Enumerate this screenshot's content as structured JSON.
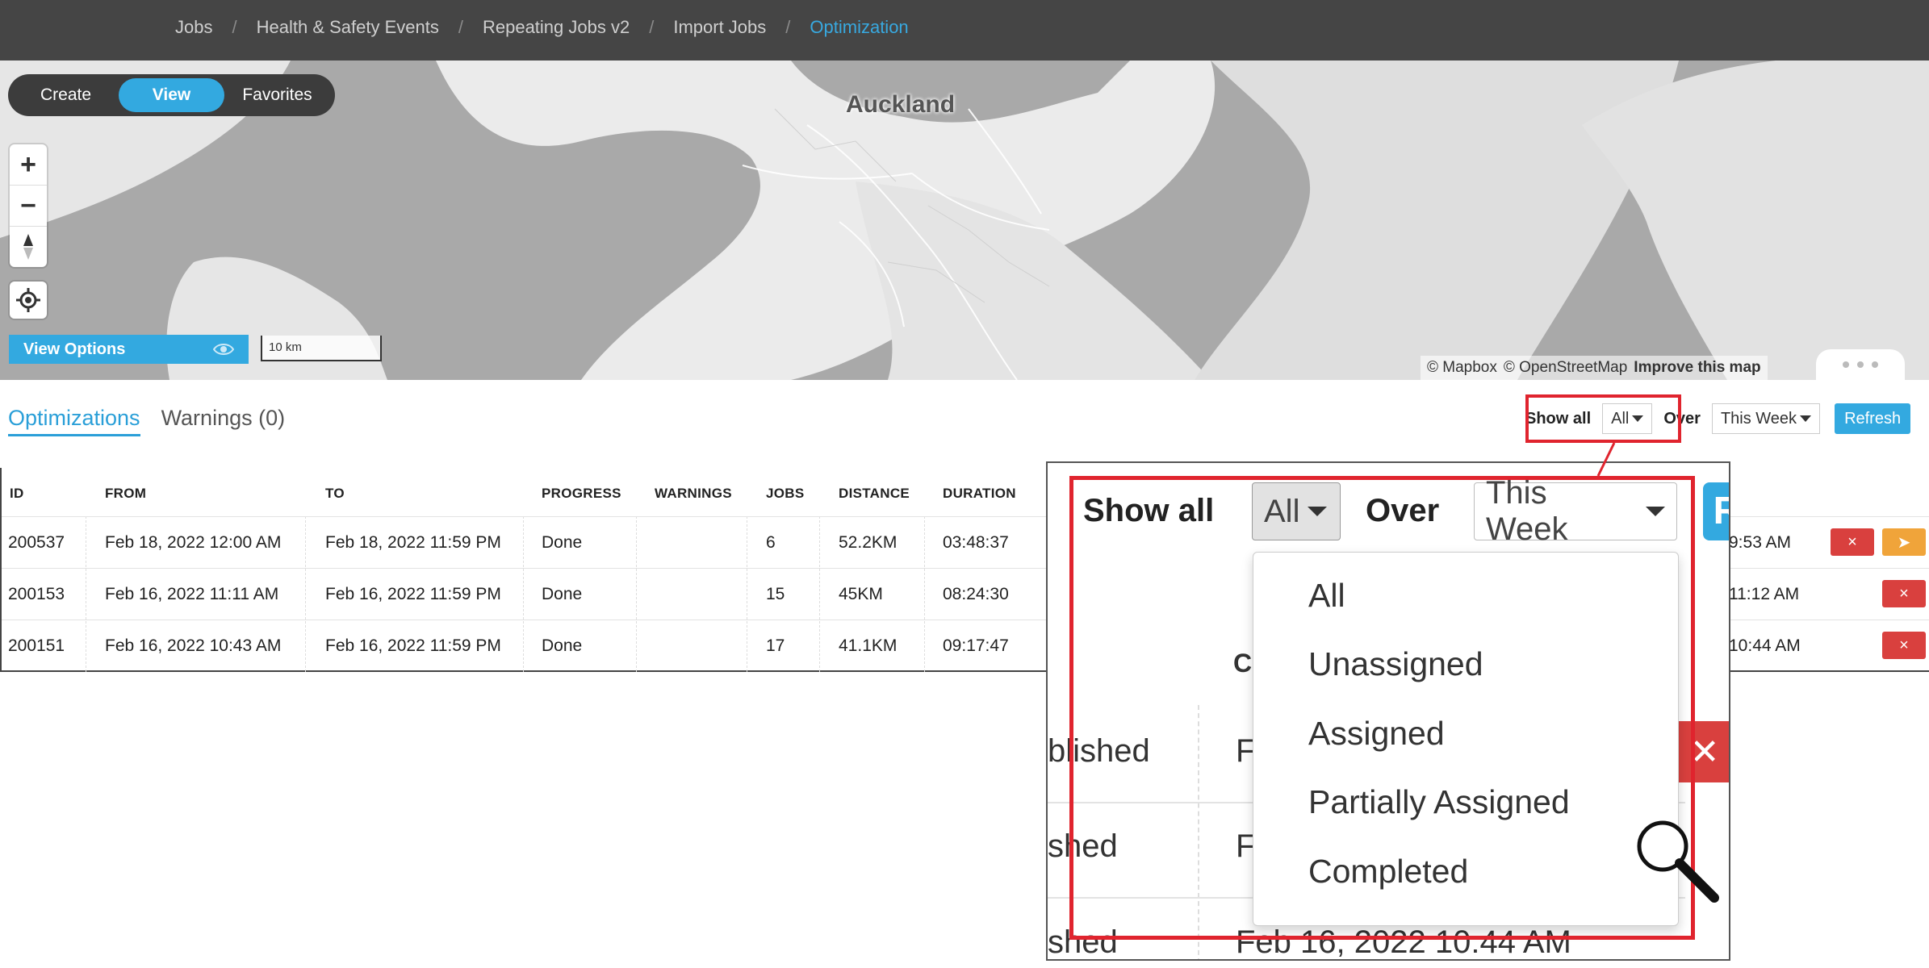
{
  "breadcrumbs": [
    "Jobs",
    "Health & Safety Events",
    "Repeating Jobs v2",
    "Import Jobs",
    "Optimization"
  ],
  "mode_toggle": {
    "create": "Create",
    "view": "View",
    "favorites": "Favorites",
    "active": "View"
  },
  "map": {
    "city_label": "Auckland",
    "zoom_in": "+",
    "zoom_out": "−",
    "view_options_label": "View Options",
    "scale_label": "10 km",
    "attribution_mapbox": "© Mapbox",
    "attribution_osm": "© OpenStreetMap",
    "improve_link": "Improve this map"
  },
  "tabs": {
    "optimizations": "Optimizations",
    "warnings": "Warnings (0)"
  },
  "filters": {
    "show_all_label": "Show all",
    "show_value": "All",
    "over_label": "Over",
    "over_value": "This Week",
    "refresh_label": "Refresh"
  },
  "table": {
    "columns": [
      "ID",
      "FROM",
      "TO",
      "PROGRESS",
      "WARNINGS",
      "JOBS",
      "DISTANCE",
      "DURATION"
    ],
    "rows": [
      {
        "id": "200537",
        "from": "Feb 18, 2022 12:00 AM",
        "to": "Feb 18, 2022 11:59 PM",
        "progress": "Done",
        "warnings": "",
        "jobs": "6",
        "distance": "52.2KM",
        "duration": "03:48:37",
        "created": "9:53 AM"
      },
      {
        "id": "200153",
        "from": "Feb 16, 2022 11:11 AM",
        "to": "Feb 16, 2022 11:59 PM",
        "progress": "Done",
        "warnings": "",
        "jobs": "15",
        "distance": "45KM",
        "duration": "08:24:30",
        "created": "11:12 AM"
      },
      {
        "id": "200151",
        "from": "Feb 16, 2022 10:43 AM",
        "to": "Feb 16, 2022 11:59 PM",
        "progress": "Done",
        "warnings": "",
        "jobs": "17",
        "distance": "41.1KM",
        "duration": "09:17:47",
        "created": "10:44 AM"
      }
    ],
    "delete_symbol": "×",
    "publish_symbol": "➤"
  },
  "callout": {
    "show_all_label": "Show all",
    "show_value": "All",
    "over_label": "Over",
    "over_value": "This Week",
    "refresh_partial": "R",
    "column_partial": "C",
    "row_partials": [
      "blished",
      "shed",
      "shed"
    ],
    "from_partials": [
      "F",
      "F"
    ],
    "bottom_date": "Feb 16, 2022 10:44 AM",
    "delete_symbol": "✕",
    "dropdown_options": [
      "All",
      "Unassigned",
      "Assigned",
      "Partially Assigned",
      "Completed"
    ]
  },
  "colors": {
    "accent": "#33a9e0",
    "highlight": "#e0242e",
    "danger": "#d9403e",
    "warning": "#f0a43a",
    "nav_bg": "#454545"
  }
}
